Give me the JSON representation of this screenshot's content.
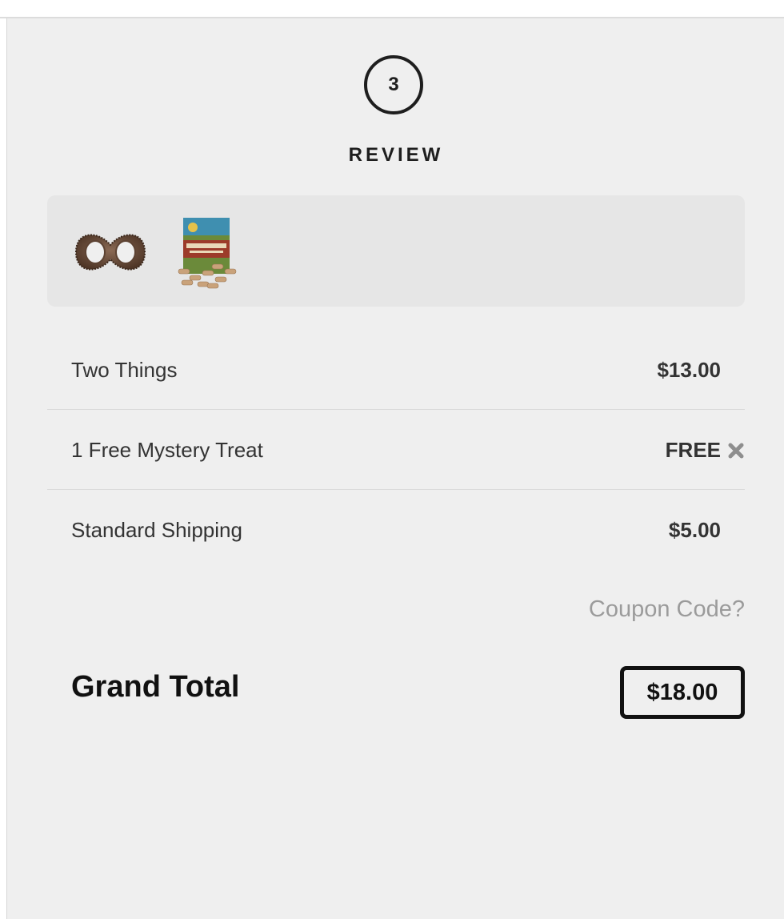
{
  "step": {
    "number": "3",
    "title": "REVIEW"
  },
  "products": [
    {
      "icon": "chew-toy-image"
    },
    {
      "icon": "treat-box-image"
    }
  ],
  "line_items": [
    {
      "label": "Two Things",
      "amount": "$13.00"
    },
    {
      "label": "1 Free Mystery Treat",
      "amount": "FREE"
    },
    {
      "label": "Standard Shipping",
      "amount": "$5.00"
    }
  ],
  "coupon": {
    "label": "Coupon Code?"
  },
  "total": {
    "label": "Grand Total",
    "amount": "$18.00"
  },
  "colors": {
    "panel_bg": "#efefef",
    "thumb_bg": "#e6e6e6",
    "text": "#333333",
    "muted": "#9b9b9b",
    "dark": "#111111"
  }
}
